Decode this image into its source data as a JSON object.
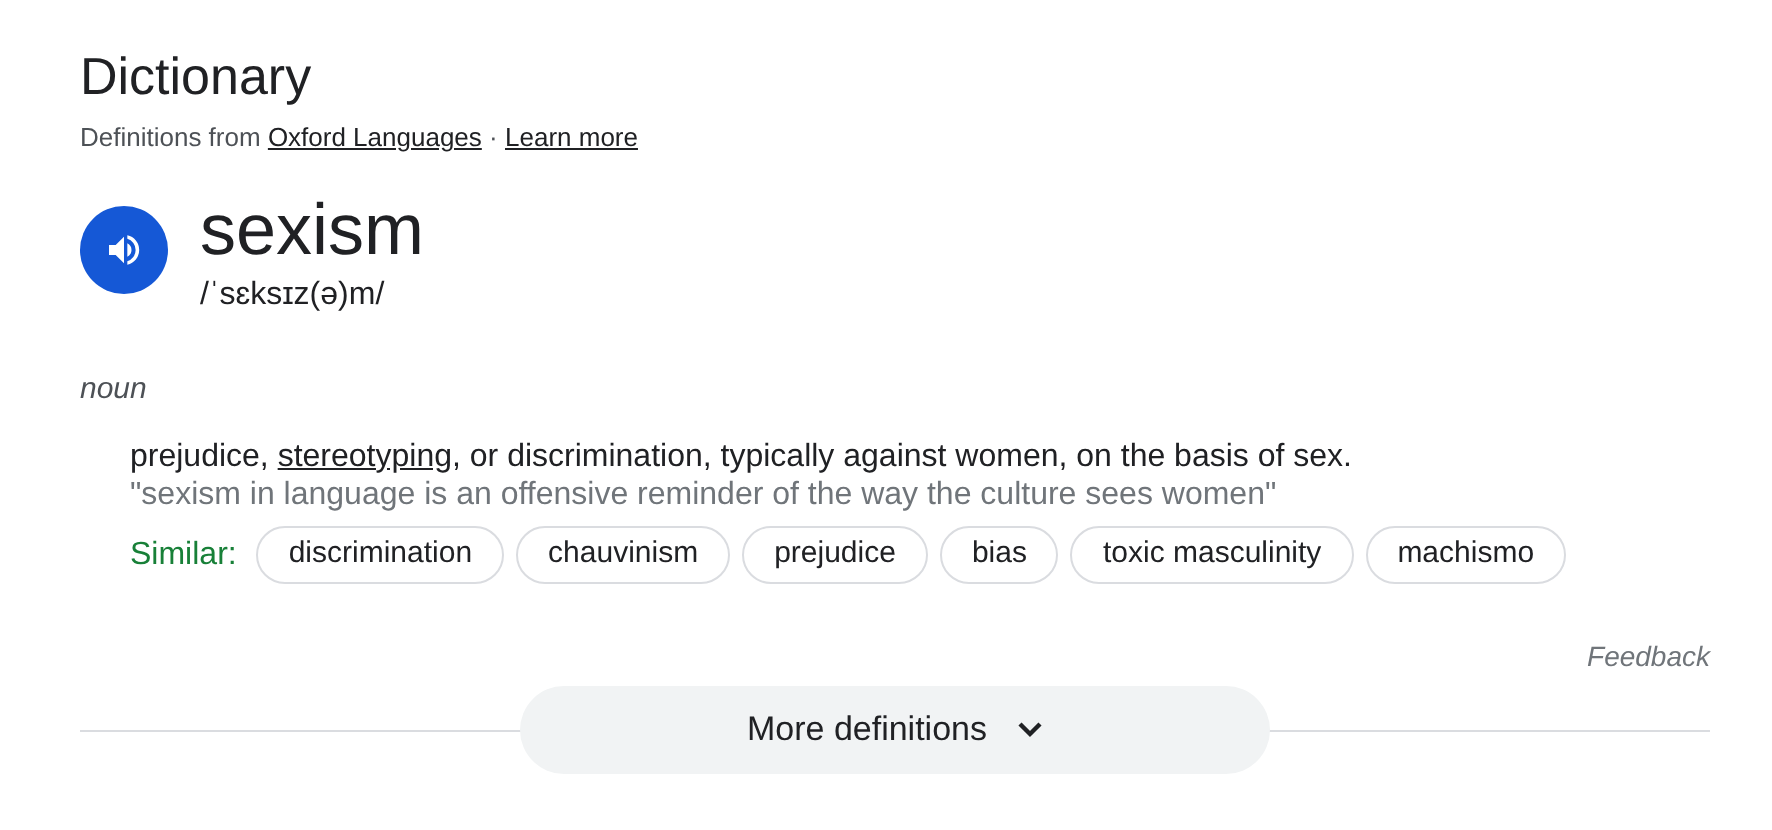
{
  "title": "Dictionary",
  "source": {
    "prefix": "Definitions from",
    "source_link": "Oxford Languages",
    "separator": "·",
    "learn_more": "Learn more"
  },
  "entry": {
    "word": "sexism",
    "pronunciation": "/ˈsɛksɪz(ə)m/"
  },
  "part_of_speech": "noun",
  "definition": {
    "before": "prejudice, ",
    "link": "stereotyping",
    "after": ", or discrimination, typically against women, on the basis of sex.",
    "example": "\"sexism in language is an offensive reminder of the way the culture sees women\""
  },
  "similar": {
    "label": "Similar:",
    "terms": [
      "discrimination",
      "chauvinism",
      "prejudice",
      "bias",
      "toxic masculinity",
      "machismo"
    ]
  },
  "feedback": "Feedback",
  "more_button": "More definitions"
}
